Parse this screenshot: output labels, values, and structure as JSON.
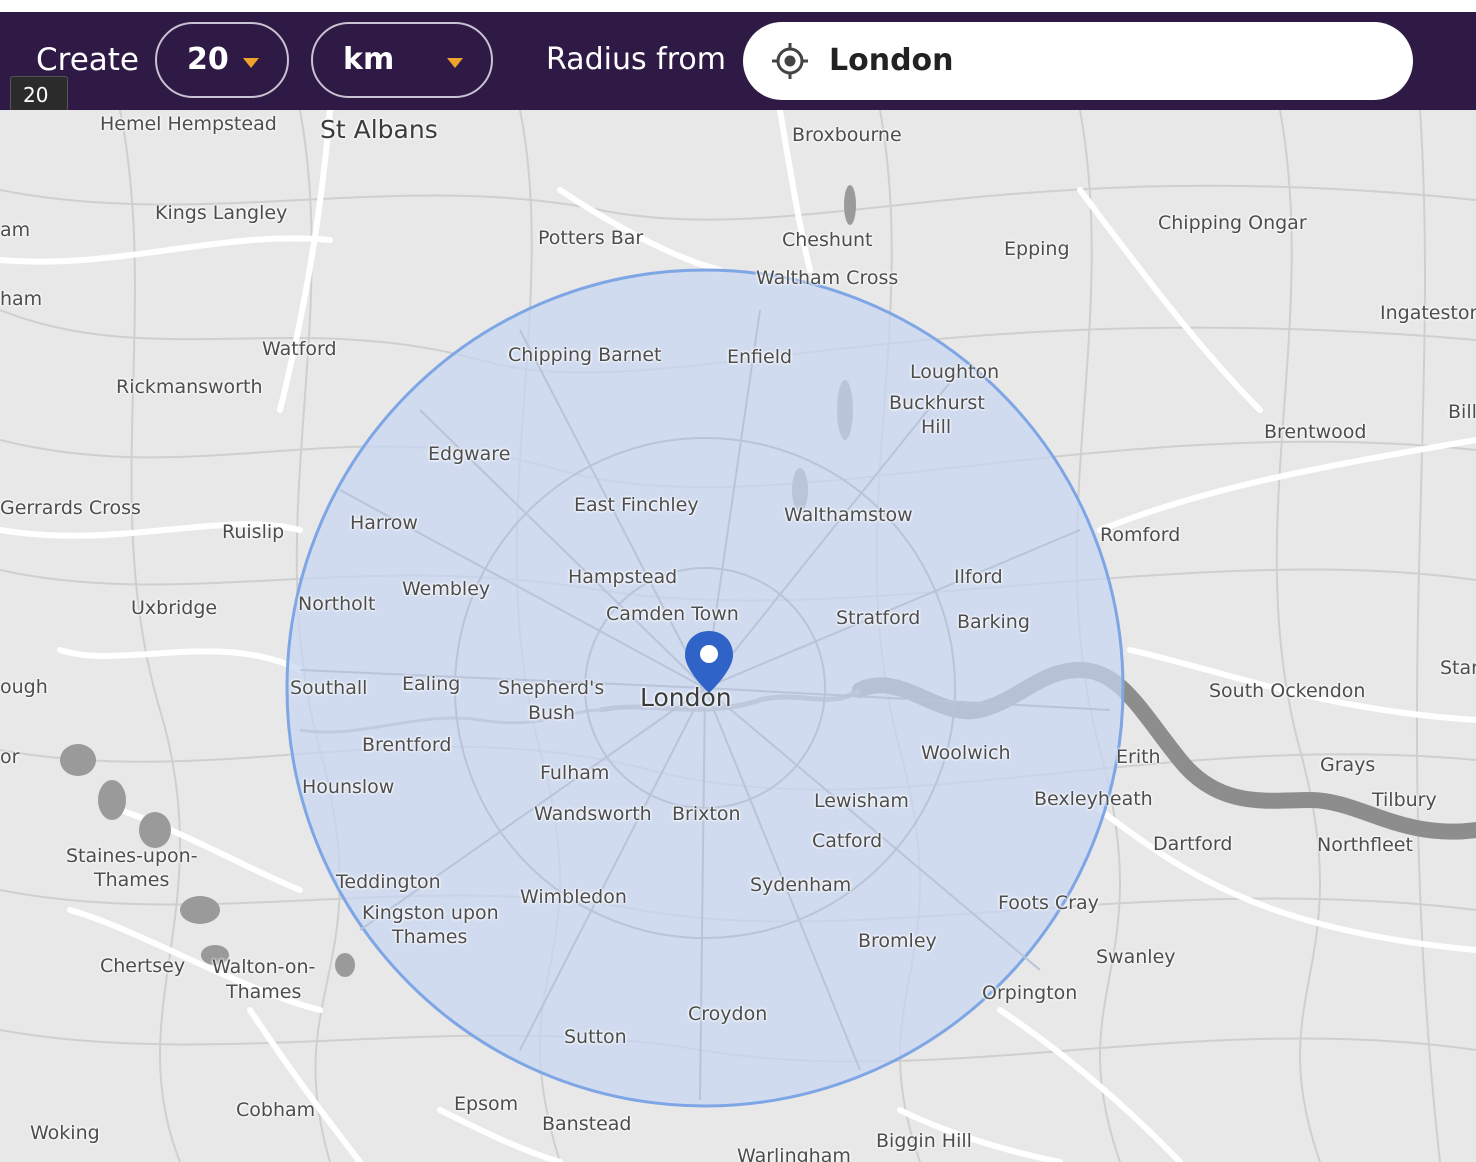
{
  "toolbar": {
    "create_label": "Create",
    "tooltip": "20",
    "radius_value": "20",
    "unit_value": "km",
    "radius_from_label": "Radius from",
    "location_value": "London",
    "caret_color": "#f0a32c",
    "background_color": "#2f1a46"
  },
  "icons": {
    "location_target": "crosshair-target-icon",
    "map_pin": "map-pin-icon",
    "dropdown_caret": "caret-down-icon"
  },
  "map": {
    "center_place": "London",
    "radius_km": 20,
    "radius_fill_color": "#c6d6f2",
    "radius_stroke_color": "#7ea6e4",
    "pin_color": "#2f63c7",
    "places": [
      "Hemel Hempstead",
      "St Albans",
      "Broxbourne",
      "Kings Langley",
      "Potters Bar",
      "Cheshunt",
      "Epping",
      "Chipping Ongar",
      "Waltham Cross",
      "Watford",
      "Ingatestone",
      "Rickmansworth",
      "Chipping Barnet",
      "Enfield",
      "Loughton",
      "Buckhurst",
      "Hill",
      "Brentwood",
      "Edgware",
      "Gerrards Cross",
      "Ruislip",
      "East Finchley",
      "Harrow",
      "Walthamstow",
      "Romford",
      "Hampstead",
      "Ilford",
      "Uxbridge",
      "Wembley",
      "Northolt",
      "Camden Town",
      "Stratford",
      "Barking",
      "Southall",
      "Ealing",
      "Shepherd's",
      "Bush",
      "London",
      "South Ockendon",
      "Brentford",
      "Woolwich",
      "Erith",
      "Grays",
      "Fulham",
      "Hounslow",
      "Bexleyheath",
      "Tilbury",
      "Lewisham",
      "Wandsworth",
      "Brixton",
      "Dartford",
      "Northfleet",
      "Staines-upon-",
      "Thames",
      "Catford",
      "Teddington",
      "Sydenham",
      "Wimbledon",
      "Kingston upon",
      "Foots Cray",
      "Bromley",
      "Chertsey",
      "Walton-on-",
      "Swanley",
      "Orpington",
      "Croydon",
      "Sutton",
      "Cobham",
      "Epsom",
      "Woking",
      "Banstead",
      "Biggin Hill",
      "Warlingham",
      "am",
      "ham",
      "ough",
      "or",
      "Bill",
      "Star"
    ]
  }
}
